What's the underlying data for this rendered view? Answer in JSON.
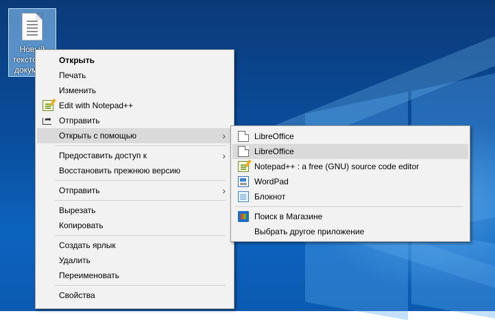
{
  "desktop": {
    "icon_label": "Новый текстовый документ",
    "icon_label_lines": [
      "Новый",
      "текстовый",
      "документ"
    ]
  },
  "context_menu": {
    "items": [
      {
        "label": "Открыть",
        "bold": true
      },
      {
        "label": "Печать"
      },
      {
        "label": "Изменить"
      },
      {
        "label": "Edit with Notepad++",
        "icon": "notepad-plus-plus-icon"
      },
      {
        "label": "Отправить",
        "icon": "share-icon"
      },
      {
        "label": "Открыть с помощью",
        "submenu": true,
        "highlighted": true
      },
      {
        "label": "Предоставить доступ к",
        "submenu": true
      },
      {
        "label": "Восстановить прежнюю версию"
      },
      {
        "label": "Отправить",
        "submenu": true
      },
      {
        "label": "Вырезать"
      },
      {
        "label": "Копировать"
      },
      {
        "label": "Создать ярлык"
      },
      {
        "label": "Удалить"
      },
      {
        "label": "Переименовать"
      },
      {
        "label": "Свойства"
      }
    ]
  },
  "open_with_submenu": {
    "items": [
      {
        "label": "LibreOffice",
        "icon": "libreoffice-document-icon"
      },
      {
        "label": "LibreOffice",
        "icon": "libreoffice-document-icon",
        "highlighted": true
      },
      {
        "label": "Notepad++ : a free (GNU) source code editor",
        "icon": "notepad-plus-plus-icon"
      },
      {
        "label": "WordPad",
        "icon": "wordpad-icon"
      },
      {
        "label": "Блокнот",
        "icon": "notepad-icon"
      },
      {
        "label": "Поиск в Магазине",
        "icon": "store-icon"
      },
      {
        "label": "Выбрать другое приложение"
      }
    ]
  },
  "colors": {
    "menu_background": "#f2f2f2",
    "highlight": "#dadada",
    "separator": "#d0d0d0"
  }
}
